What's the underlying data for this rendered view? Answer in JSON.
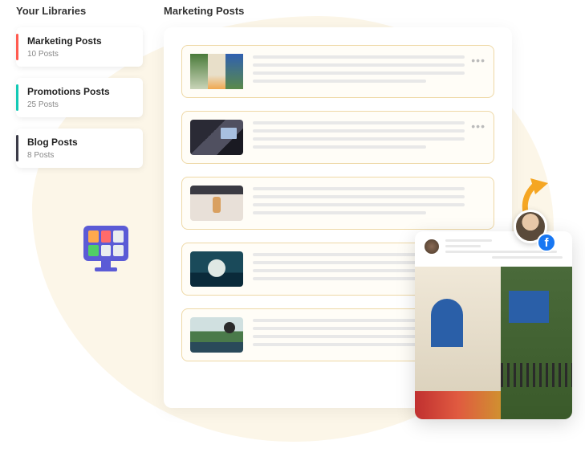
{
  "sidebar": {
    "title": "Your Libraries",
    "items": [
      {
        "name": "Marketing Posts",
        "count": "10 Posts"
      },
      {
        "name": "Promotions Posts",
        "count": "25 Posts"
      },
      {
        "name": "Blog Posts",
        "count": "8 Posts"
      }
    ]
  },
  "main": {
    "title": "Marketing Posts"
  },
  "social": {
    "platform": "facebook",
    "platform_glyph": "f"
  }
}
